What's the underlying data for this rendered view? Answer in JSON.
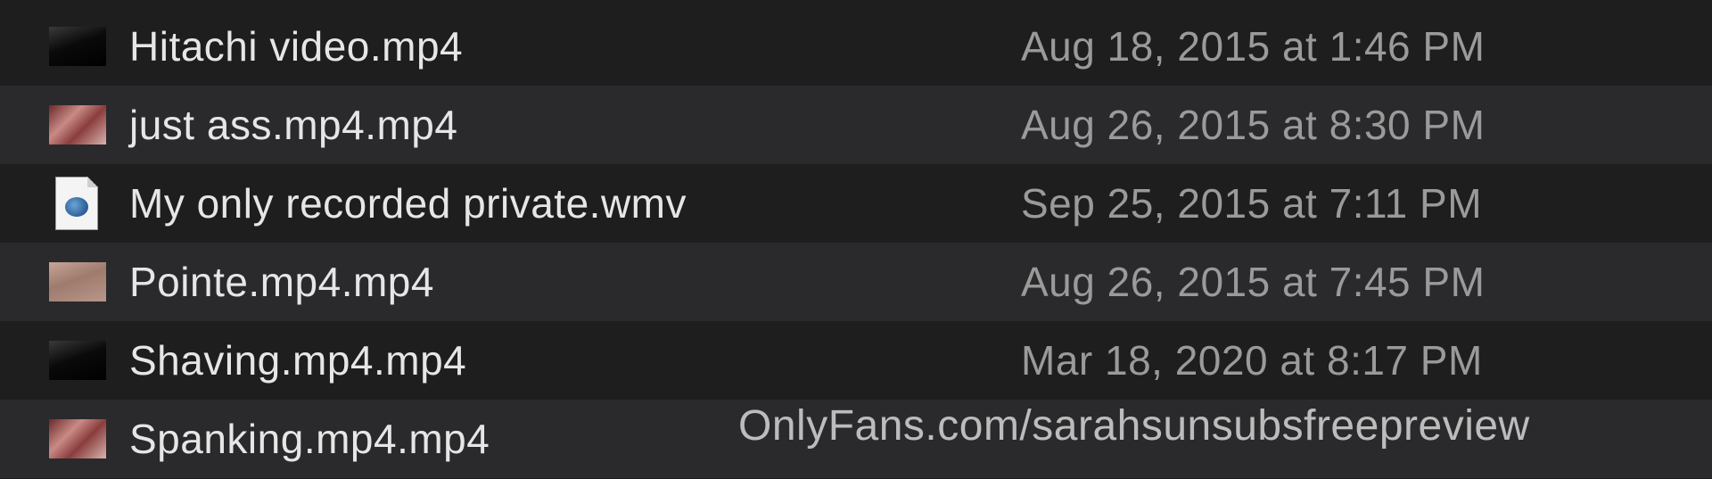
{
  "files": [
    {
      "name": "Hitachi video.mp4",
      "date": "Aug 18, 2015 at 1:46 PM",
      "icon": "video-thumbnail-icon"
    },
    {
      "name": "just ass.mp4.mp4",
      "date": "Aug 26, 2015 at 8:30 PM",
      "icon": "video-thumbnail-icon"
    },
    {
      "name": "My only recorded private.wmv",
      "date": "Sep 25, 2015 at 7:11 PM",
      "icon": "wmv-document-icon"
    },
    {
      "name": "Pointe.mp4.mp4",
      "date": "Aug 26, 2015 at 7:45 PM",
      "icon": "video-thumbnail-icon"
    },
    {
      "name": "Shaving.mp4.mp4",
      "date": "Mar 18, 2020 at 8:17 PM",
      "icon": "video-thumbnail-icon"
    },
    {
      "name": "Spanking.mp4.mp4",
      "date": "",
      "icon": "video-thumbnail-icon"
    }
  ],
  "watermark": "OnlyFans.com/sarahsunsubsfreepreview",
  "colors": {
    "background": "#1e1e1e",
    "row_alt": "#2a2a2c",
    "filename_text": "#e6e6e6",
    "date_text": "#9a9a9a"
  }
}
